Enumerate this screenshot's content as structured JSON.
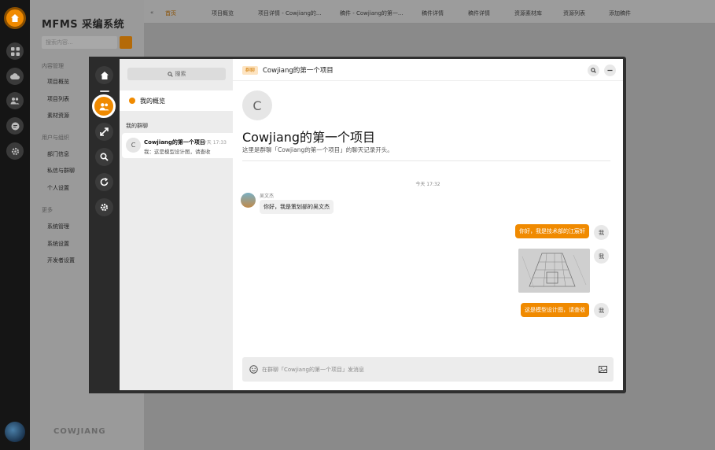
{
  "app": {
    "title": "MFMS 采编系统",
    "search_placeholder": "搜索内容...",
    "footer_logo": "COWJIANG",
    "accent": "#f08a00"
  },
  "sidebar": {
    "sections": [
      {
        "label": "内容管理",
        "items": [
          "项目概览",
          "项目列表",
          "素材资源"
        ]
      },
      {
        "label": "用户与组织",
        "items": [
          "部门信息",
          "私信与群聊",
          "个人设置"
        ]
      },
      {
        "label": "更多",
        "items": [
          "系统管理",
          "系统设置",
          "开发者设置"
        ]
      }
    ]
  },
  "tabs": [
    "首页",
    "项目概览",
    "项目详情 - Cowjiang的...",
    "稿件 - Cowjiang的第一...",
    "稿件详情",
    "稿件详情",
    "资源素材库",
    "资源列表",
    "添加稿件"
  ],
  "modal": {
    "rail_icons": [
      "home-icon",
      "users-icon",
      "expand-icon",
      "search-icon",
      "refresh-icon",
      "settings-icon"
    ],
    "search_label": "搜索",
    "overview_label": "我的概览",
    "groups_section": "我的群聊",
    "group_item": {
      "avatar_letter": "C",
      "name": "Cowjiang的第一个项目",
      "time": "今天 17:33",
      "preview": "我：这是模型设计图，请查收"
    },
    "chat": {
      "badge": "群聊",
      "header_title": "Cowjiang的第一个项目",
      "avatar_letter": "C",
      "group_title": "Cowjiang的第一个项目",
      "group_desc": "这里是群聊「Cowjiang的第一个项目」的聊天记录开头。",
      "time_divider": "今天 17:32",
      "messages": [
        {
          "direction": "in",
          "sender": "吴文杰",
          "text": "你好，我是策划部的吴文杰"
        },
        {
          "direction": "out",
          "sender": "我",
          "text": "你好，我是技术部的江宸轩"
        },
        {
          "direction": "out",
          "sender": "我",
          "image": "sketch-image"
        },
        {
          "direction": "out",
          "sender": "我",
          "text": "这是模型设计图，请查收"
        }
      ],
      "input_placeholder": "在群聊「Cowjiang的第一个项目」发消息"
    }
  }
}
